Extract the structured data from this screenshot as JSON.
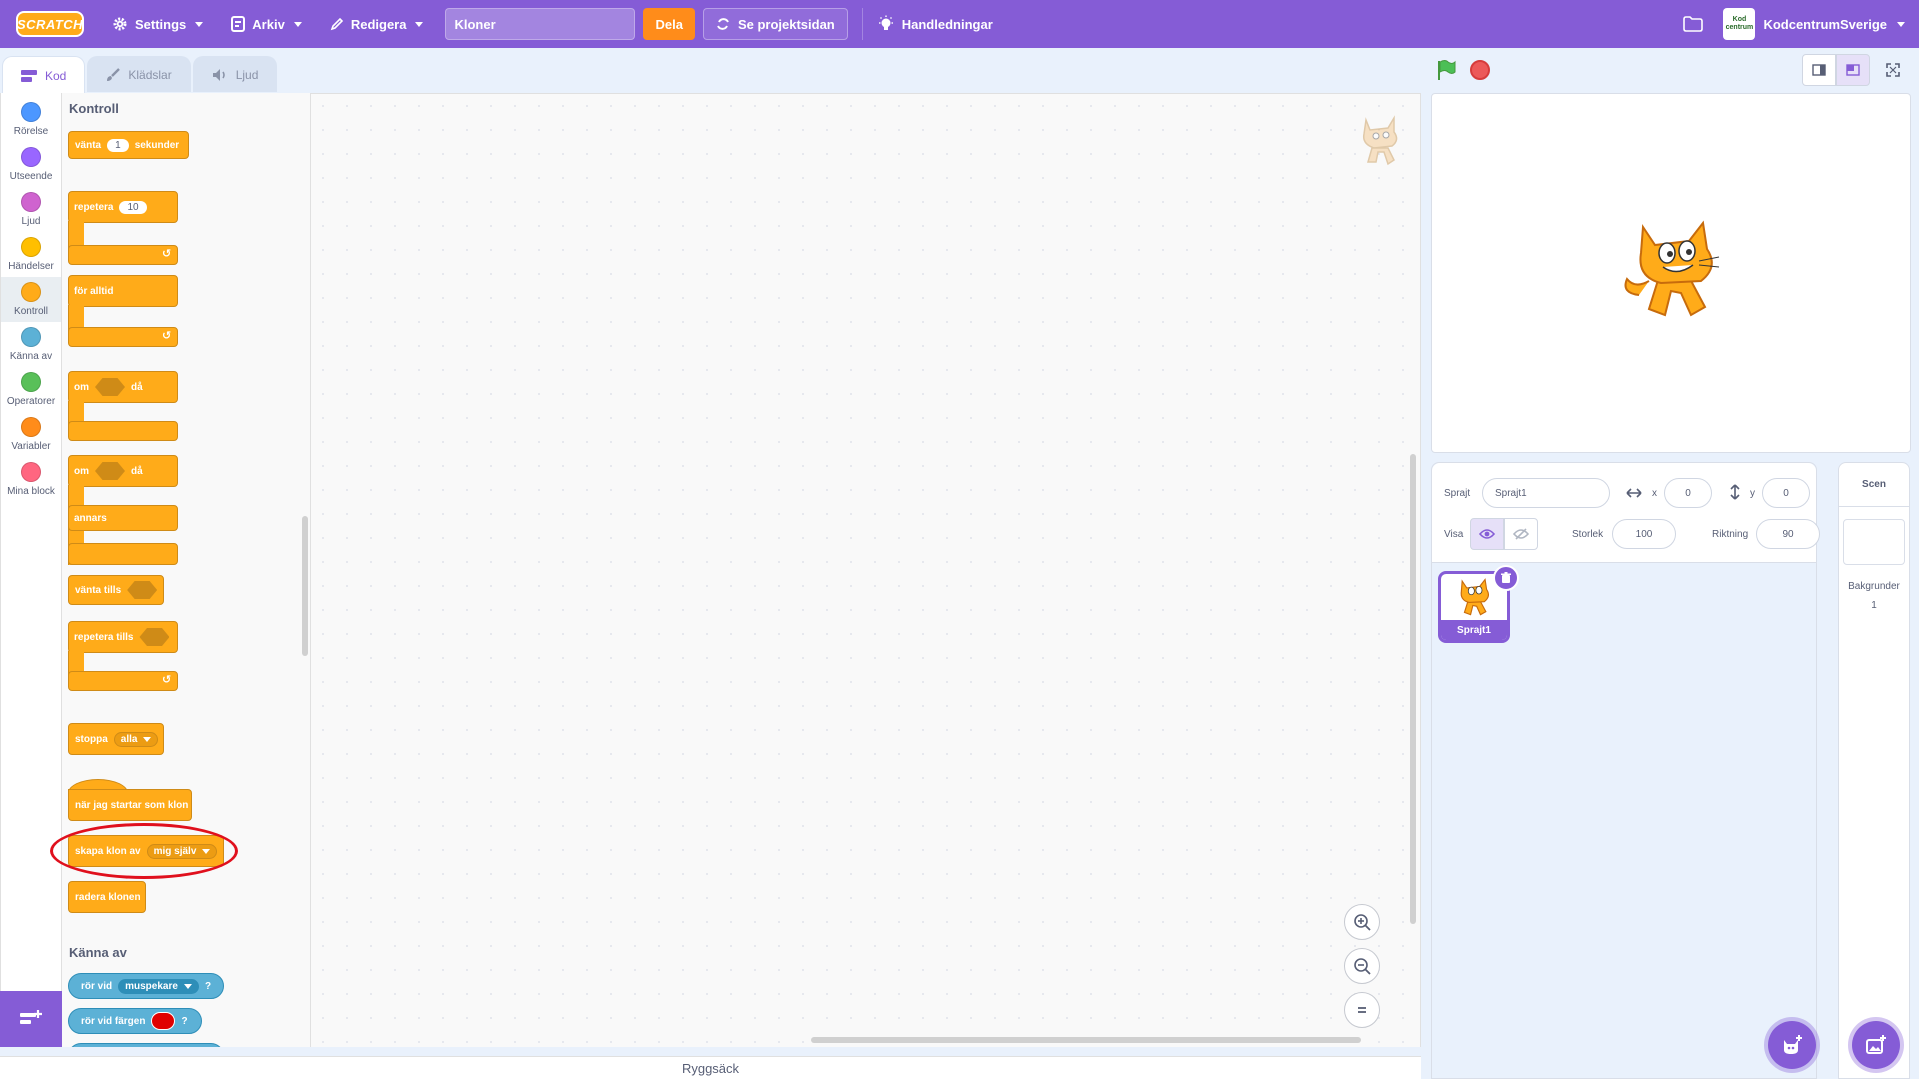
{
  "menubar": {
    "logo": "SCRATCH",
    "settings": "Settings",
    "file": "Arkiv",
    "edit": "Redigera",
    "project_title": "Kloner",
    "share": "Dela",
    "see_project": "Se projektsidan",
    "tutorials": "Handledningar",
    "user": "KodcentrumSverige",
    "avatar_text": "Kod centrum"
  },
  "tabs": {
    "code": "Kod",
    "costumes": "Klädslar",
    "sounds": "Ljud"
  },
  "categories": [
    {
      "label": "Rörelse",
      "color": "#4c97ff"
    },
    {
      "label": "Utseende",
      "color": "#9966ff"
    },
    {
      "label": "Ljud",
      "color": "#cf63cf"
    },
    {
      "label": "Händelser",
      "color": "#ffbf00"
    },
    {
      "label": "Kontroll",
      "color": "#ffab19"
    },
    {
      "label": "Känna av",
      "color": "#5cb1d6"
    },
    {
      "label": "Operatorer",
      "color": "#59c059"
    },
    {
      "label": "Variabler",
      "color": "#ff8c1a"
    },
    {
      "label": "Mina block",
      "color": "#ff6680"
    }
  ],
  "palette": {
    "control_title": "Kontroll",
    "wait": "vänta",
    "wait_value": "1",
    "wait_unit": "sekunder",
    "repeat": "repetera",
    "repeat_value": "10",
    "forever": "för alltid",
    "if1": "om",
    "then1": "då",
    "if2": "om",
    "then2": "då",
    "else": "annars",
    "wait_until": "vänta tills",
    "repeat_until": "repetera tills",
    "stop": "stoppa",
    "stop_option": "alla",
    "when_clone": "när jag startar som klon",
    "create_clone": "skapa klon av",
    "clone_option": "mig själv",
    "delete_clone": "radera klonen",
    "sensing_title": "Känna av",
    "touching": "rör vid",
    "touching_option": "muspekare",
    "touching_q": "?",
    "touching_color": "rör vid färgen",
    "touching_color_q": "?"
  },
  "backpack": "Ryggsäck",
  "sprite_info": {
    "sprite_label": "Sprajt",
    "sprite_name": "Sprajt1",
    "x_label": "x",
    "x_value": "0",
    "y_label": "y",
    "y_value": "0",
    "show_label": "Visa",
    "size_label": "Storlek",
    "size_value": "100",
    "direction_label": "Riktning",
    "direction_value": "90"
  },
  "sprites": [
    {
      "name": "Sprajt1"
    }
  ],
  "stage_pane": {
    "title": "Scen",
    "backdrops_label": "Bakgrunder",
    "backdrops_count": "1"
  }
}
